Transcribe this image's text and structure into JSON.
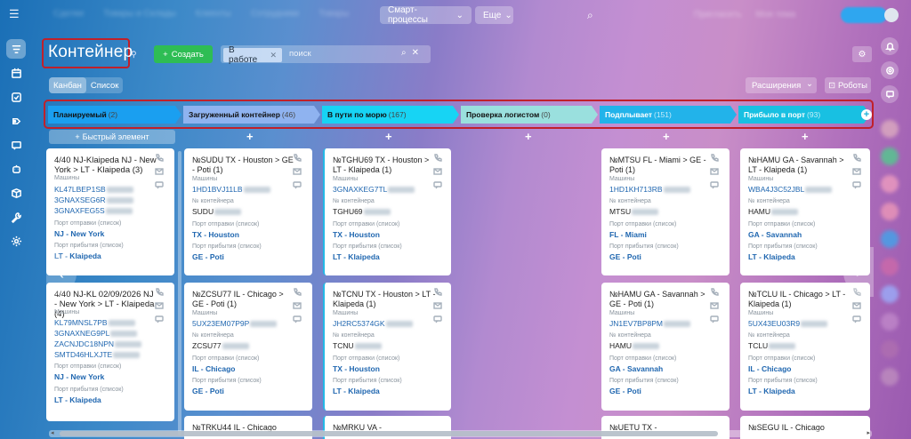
{
  "topbar": {
    "nav_blurred": [
      "Сделки",
      "Товары и Склады",
      "Клиенты",
      "Сотрудники",
      "Товары"
    ],
    "smart_processes": "Смарт-процессы",
    "more": "Еще",
    "right_blurred": [
      "Пригласить",
      "Моя тема"
    ]
  },
  "header": {
    "title": "Контейнер",
    "create_label": "Создать",
    "filter_chip": "В работе",
    "search_placeholder": "поиск",
    "view_tabs": [
      "Канбан",
      "Список"
    ],
    "extensions_label": "Расширения",
    "robots_label": "Роботы"
  },
  "stages": [
    {
      "name": "Планируемый",
      "count": "(2)",
      "color": "#1a9ff0"
    },
    {
      "name": "Загруженный контейнер",
      "count": "(46)",
      "color": "#8fb3f0"
    },
    {
      "name": "В пути по морю",
      "count": "(167)",
      "color": "#17d4f4"
    },
    {
      "name": "Проверка логистом",
      "count": "(0)",
      "color": "#9ae0de"
    },
    {
      "name": "Подплывает",
      "count": "(151)",
      "color": "#22b3ea"
    },
    {
      "name": "Прибыло в порт",
      "count": "(93)",
      "color": "#18c0e2"
    }
  ],
  "quick_add_label": "Быстрый элемент",
  "labels": {
    "machines": "Машины",
    "container_no": "№ контейнера",
    "port_departure": "Порт отправки (список)",
    "port_arrival": "Порт прибытия (список)"
  },
  "cards": [
    {
      "title": "4/40 NJ-Klaipeda NJ - New York > LT - Klaipeda (3)",
      "machines": [
        "KL47LBEP1SB",
        "3GNAXSEG6R",
        "3GNAXFEG5S"
      ],
      "container": "",
      "dep": "NJ - New York",
      "arr": "LT - Klaipeda"
    },
    {
      "title": "4/40 NJ-KL 02/09/2026 NJ - New York > LT - Klaipeda (4)",
      "machines": [
        "KL79MNSL7PB",
        "3GNAXNEG9PL",
        "ZACNJDC18NPN",
        "SMTD46HLXJTE"
      ],
      "container": "",
      "dep": "NJ - New York",
      "arr": "LT - Klaipeda"
    },
    {
      "title": "№SUDU TX - Houston > GE - Poti (1)",
      "machines": [
        "1HD1BVJ11LB"
      ],
      "container": "SUDU",
      "dep": "TX - Houston",
      "arr": "GE - Poti"
    },
    {
      "title": "№ZCSU77 IL - Chicago > GE - Poti (1)",
      "machines": [
        "5UX23EM07P9P"
      ],
      "container": "ZCSU77",
      "dep": "IL - Chicago",
      "arr": "GE - Poti"
    },
    {
      "title": "№TRKU44 IL - Chicago",
      "machines": [],
      "container": "",
      "dep": "",
      "arr": ""
    },
    {
      "title": "№TGHU69 TX - Houston > LT - Klaipeda (1)",
      "machines": [
        "3GNAXKEG7TL"
      ],
      "container": "TGHU69",
      "dep": "TX - Houston",
      "arr": "LT - Klaipeda"
    },
    {
      "title": "№TCNU TX - Houston > LT - Klaipeda (1)",
      "machines": [
        "JH2RC5374GK"
      ],
      "container": "TCNU",
      "dep": "TX - Houston",
      "arr": "LT - Klaipeda"
    },
    {
      "title": "№MRKU VA -",
      "machines": [],
      "container": "",
      "dep": "",
      "arr": ""
    },
    {
      "title": "№MTSU FL - Miami > GE - Poti (1)",
      "machines": [
        "1HD1KH713RB"
      ],
      "container": "MTSU",
      "dep": "FL - Miami",
      "arr": "GE - Poti"
    },
    {
      "title": "№HAMU GA - Savannah > GE - Poti (1)",
      "machines": [
        "JN1EV7BP8PM"
      ],
      "container": "HAMU",
      "dep": "GA - Savannah",
      "arr": "GE - Poti"
    },
    {
      "title": "№UETU TX -",
      "machines": [],
      "container": "",
      "dep": "",
      "arr": ""
    },
    {
      "title": "№HAMU GA - Savannah > LT - Klaipeda (1)",
      "machines": [
        "WBA4J3C52JBL"
      ],
      "container": "HAMU",
      "dep": "GA - Savannah",
      "arr": "LT - Klaipeda"
    },
    {
      "title": "№TCLU IL - Chicago > LT - Klaipeda (1)",
      "machines": [
        "5UX43EU03R9"
      ],
      "container": "TCLU",
      "dep": "IL - Chicago",
      "arr": "LT - Klaipeda"
    },
    {
      "title": "№SEGU IL - Chicago",
      "machines": [],
      "container": "",
      "dep": "",
      "arr": ""
    }
  ]
}
